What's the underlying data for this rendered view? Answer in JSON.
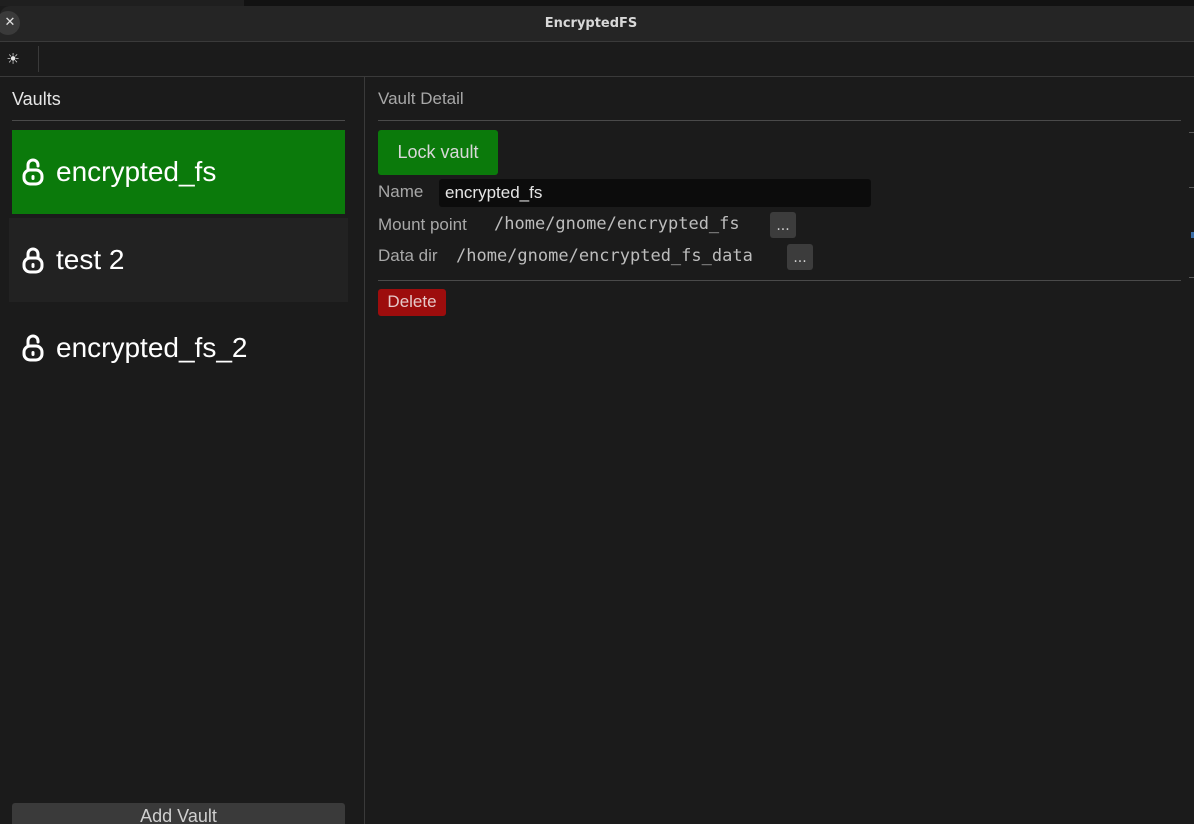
{
  "window": {
    "title": "EncryptedFS",
    "close_glyph": "✕"
  },
  "toolbar": {
    "theme_icon": "sun-icon",
    "theme_glyph": "☀"
  },
  "sidebar": {
    "heading": "Vaults",
    "items": [
      {
        "label": "encrypted_fs",
        "state": "unlocked",
        "icon": "lock-open-icon",
        "selected": true
      },
      {
        "label": "test 2",
        "state": "locked",
        "icon": "lock-closed-icon",
        "selected": false
      },
      {
        "label": "encrypted_fs_2",
        "state": "unlocked",
        "icon": "lock-open-icon",
        "selected": false
      }
    ],
    "add_button": "Add Vault"
  },
  "detail": {
    "heading": "Vault Detail",
    "lock_button": "Lock vault",
    "name_label": "Name",
    "name_value": "encrypted_fs",
    "mount_label": "Mount point",
    "mount_value": "/home/gnome/encrypted_fs",
    "data_dir_label": "Data dir",
    "data_dir_value": "/home/gnome/encrypted_fs_data",
    "browse_label": "...",
    "delete_button": "Delete"
  },
  "colors": {
    "accent_green": "#0b7a0b",
    "danger_red": "#9d0d0d",
    "background": "#1b1b1b"
  }
}
